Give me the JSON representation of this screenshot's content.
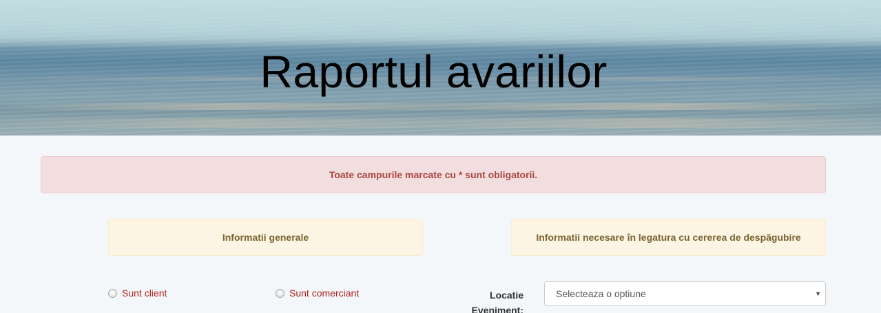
{
  "hero": {
    "title": "Raportul avariilor"
  },
  "alert": {
    "text": "Toate campurile marcate cu * sunt obligatorii."
  },
  "sections": {
    "general": "Informatii generale",
    "claim": "Informatii necesare în legatura cu cererea de despăgubire"
  },
  "radios": {
    "client": "Sunt client",
    "merchant": "Sunt comerciant"
  },
  "location": {
    "label_line1": "Locatie",
    "label_line2": "Eveniment:",
    "selected": "Selecteaza o optiune"
  },
  "colors": {
    "alert_text": "#a94442",
    "alert_bg": "#f2dede",
    "info_bg": "#fcf5e3",
    "info_text": "#7a6331",
    "radio_label": "#b0201e"
  }
}
